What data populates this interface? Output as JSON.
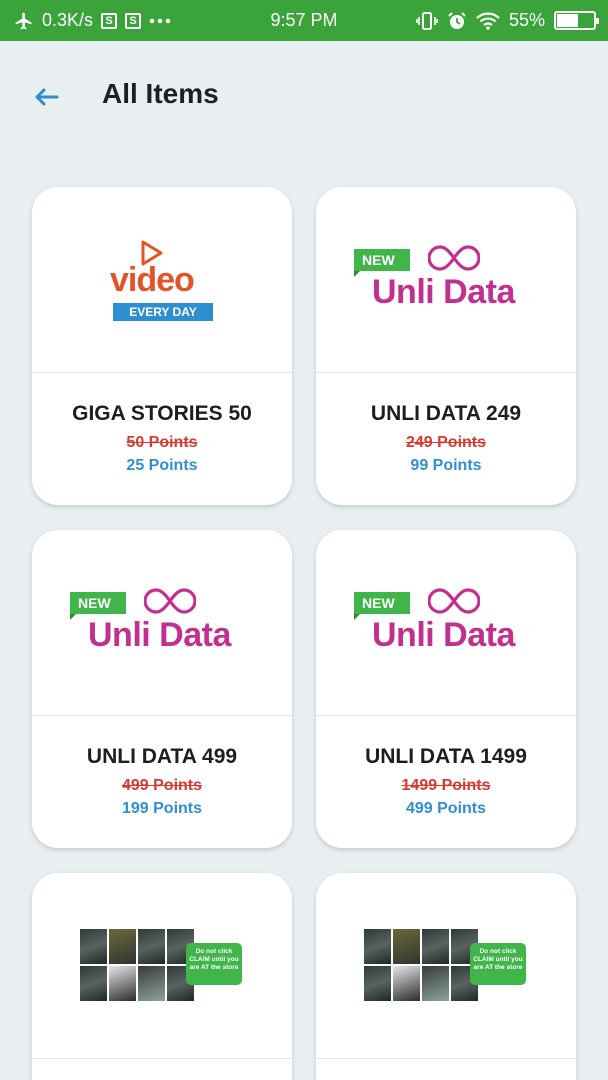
{
  "status_bar": {
    "speed": "0.3K/s",
    "time": "9:57 PM",
    "battery": "55%",
    "battery_level": 0.55
  },
  "header": {
    "title": "All Items"
  },
  "items": [
    {
      "name": "GIGA STORIES 50",
      "old_points": "50 Points",
      "new_points": "25 Points",
      "logo": "video"
    },
    {
      "name": "UNLI DATA 249",
      "old_points": "249 Points",
      "new_points": "99 Points",
      "logo": "unli"
    },
    {
      "name": "UNLI DATA 499",
      "old_points": "499 Points",
      "new_points": "199 Points",
      "logo": "unli"
    },
    {
      "name": "UNLI DATA 1499",
      "old_points": "1499 Points",
      "new_points": "499 Points",
      "logo": "unli"
    },
    {
      "name": "",
      "old_points": "",
      "new_points": "",
      "logo": "photo"
    },
    {
      "name": "",
      "old_points": "",
      "new_points": "",
      "logo": "photo"
    }
  ],
  "logos": {
    "video_word": "video",
    "video_sub": "EVERY DAY",
    "new_badge": "NEW",
    "unli_word": "Unli Data",
    "promo_bubble": "Do not click CLAIM until you are AT the store"
  },
  "colors": {
    "status_bar": "#3aa33a",
    "background": "#e9eff0",
    "old_points": "#d73a2f",
    "new_points": "#2f8fd1",
    "unli_magenta": "#c12f8f",
    "video_orange": "#e25427"
  }
}
